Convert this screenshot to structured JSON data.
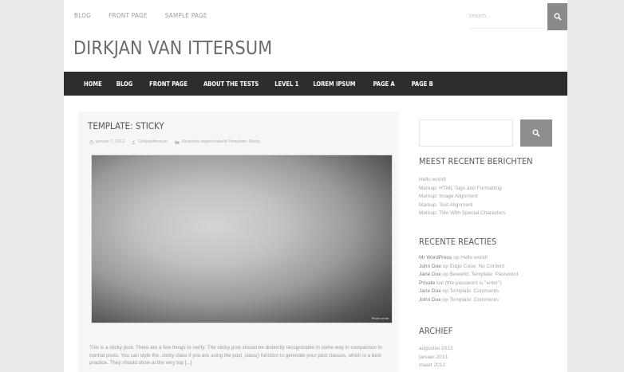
{
  "top_nav": [
    "BLOG",
    "FRONT PAGE",
    "SAMPLE PAGE"
  ],
  "top_search": {
    "placeholder": "Search..."
  },
  "site": {
    "title": "DIRKJAN VAN ITTERSUM"
  },
  "main_nav": [
    "HOME",
    "BLOG",
    "FRONT PAGE",
    "ABOUT THE TESTS",
    "LEVEL 1",
    "LOREM IPSUM",
    "PAGE A",
    "PAGE B"
  ],
  "post": {
    "title": "TEMPLATE: STICKY",
    "meta": {
      "date": "januari 7, 2012",
      "author": "Dirkjanittersum",
      "categories": "Reacties uitgeschakeld Template: Sticky"
    },
    "image_credit": "Photo credit",
    "excerpt": "This is a sticky post. There are a few things to verify: The sticky post should be distinctly recognizable in some way in comparison to normal posts. You can style the .sticky class if you are using the post_class() function to generate your post classes, which is a best practice. They should show at the very top [...]"
  },
  "sidebar": {
    "recent_posts": {
      "title": "MEEST RECENTE BERICHTEN",
      "items": [
        "Hello world!",
        "Markup: HTML Tags and Formatting",
        "Markup: Image Alignment",
        "Markup: Text Alignment",
        "Markup: Title With Special Characters"
      ]
    },
    "recent_comments": {
      "title": "RECENTE REACTIES",
      "items": [
        {
          "author": "Mr WordPress",
          "on": "op",
          "post": "Hello world!"
        },
        {
          "author": "John Doe",
          "on": "op",
          "post": "Edge Case: No Content"
        },
        {
          "author": "Jane Doe",
          "on": "op",
          "post": "Bewerkt: Template: Password"
        },
        {
          "author": "Private",
          "on": "",
          "post": "but (the password is \"enter\")"
        },
        {
          "author": "Jane Doe",
          "on": "op",
          "post": "Template: Comments"
        },
        {
          "author": "John Doe",
          "on": "op",
          "post": "Template: Comments"
        }
      ]
    },
    "archive": {
      "title": "ARCHIEF",
      "items": [
        "augustus 2013",
        "januari 2013",
        "maart 2012"
      ]
    }
  },
  "colors": {
    "nav_bg": "#2d2d2d",
    "button_bg": "#8a8a8a",
    "page_bg": "#e9e9e9"
  }
}
